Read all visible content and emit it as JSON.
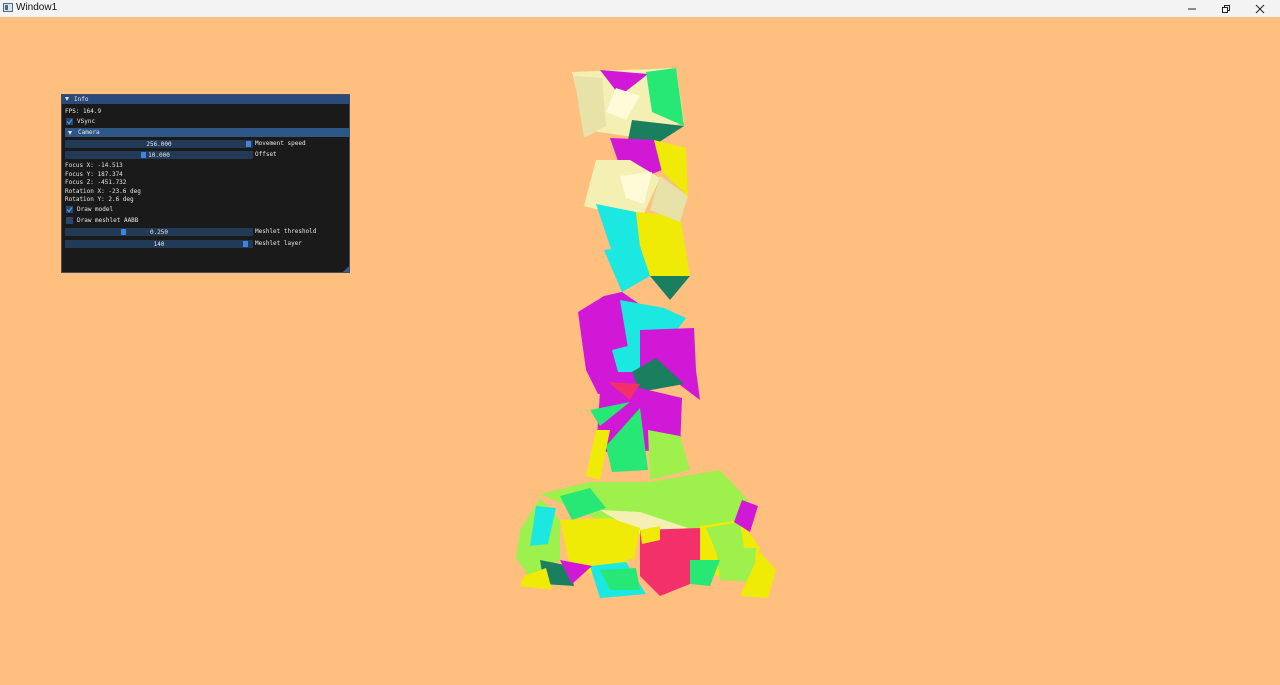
{
  "window": {
    "title": "Window1",
    "minimize_icon": "minimize-icon",
    "maximize_icon": "restore-icon",
    "close_icon": "close-icon"
  },
  "colors": {
    "background": "#febf7f",
    "panel_bg": "#1a1a1a",
    "header": "#294a7a",
    "section": "#2e5686",
    "slider_frame": "#233a57",
    "slider_grab": "#3d85e0",
    "model_palette": [
      "#f4f0b4",
      "#27e874",
      "#f0ea07",
      "#1be8e0",
      "#d018d6",
      "#f3306a",
      "#9ef04c",
      "#1a7f5e"
    ]
  },
  "panel": {
    "title": "Info",
    "fps": "FPS: 164.9",
    "vsync": {
      "label": "VSync",
      "checked": true
    },
    "camera_section": "Camera",
    "movement_speed": {
      "value": "256.000",
      "label": "Movement speed",
      "fraction": 1.0
    },
    "offset": {
      "value": "10.000",
      "label": "Offset",
      "fraction": 0.42
    },
    "focus_x": "Focus X: -14.513",
    "focus_y": "Focus Y: 187.374",
    "focus_z": "Focus Z: -451.732",
    "rotation_x": "Rotation X: -23.6 deg",
    "rotation_y": "Rotation Y: 2.6 deg",
    "draw_model": {
      "label": "Draw model",
      "checked": true
    },
    "draw_aabb": {
      "label": "Draw meshlet AABB",
      "checked": false
    },
    "meshlet_threshold": {
      "value": "0.250",
      "label": "Meshlet threshold",
      "fraction": 0.32
    },
    "meshlet_layer": {
      "value": "140",
      "label": "Meshlet layer",
      "fraction": 1.0
    }
  }
}
